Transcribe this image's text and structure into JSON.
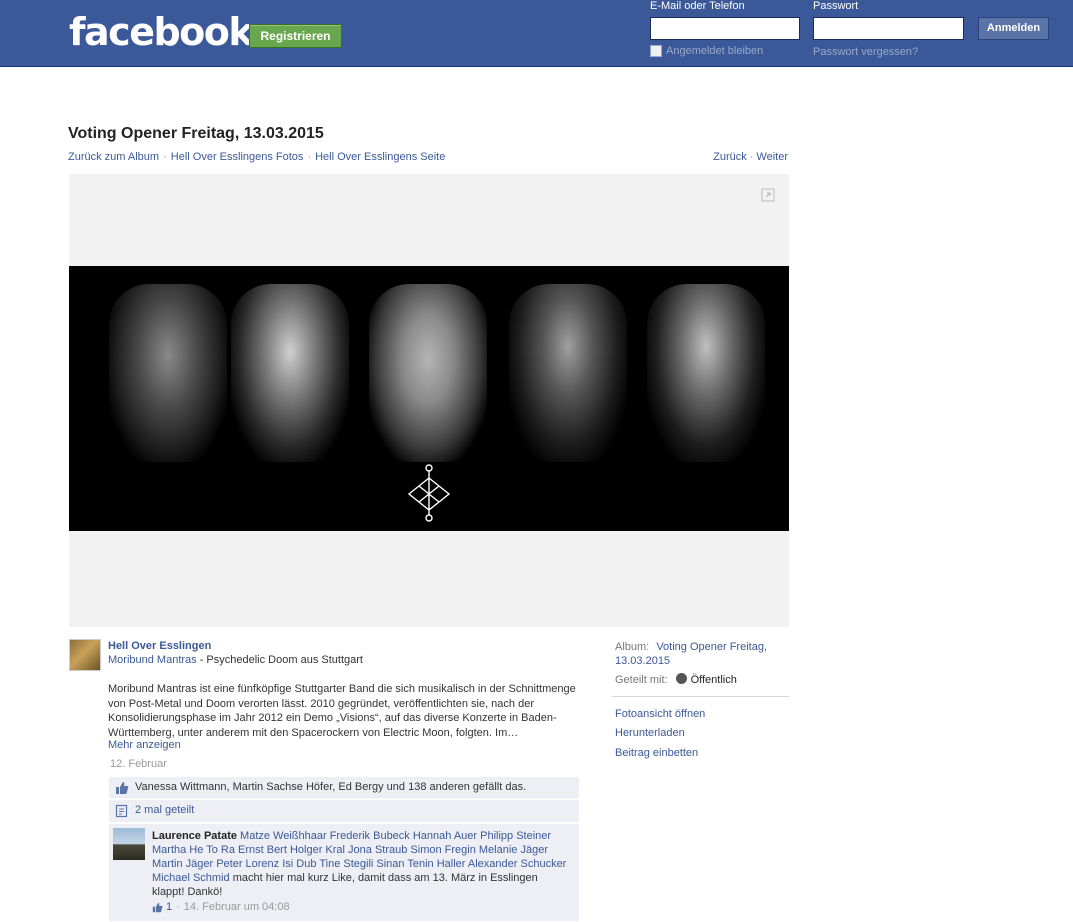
{
  "header": {
    "logo": "facebook",
    "register_label": "Registrieren",
    "email_label": "E-Mail oder Telefon",
    "password_label": "Passwort",
    "keep_logged_in": "Angemeldet bleiben",
    "forgot_password": "Passwort vergessen?",
    "login_label": "Anmelden"
  },
  "photo_page": {
    "title": "Voting Opener Freitag, 13.03.2015",
    "breadcrumbs": [
      "Zurück zum Album",
      "Hell Over Esslingens Fotos",
      "Hell Over Esslingens Seite"
    ],
    "nav": [
      "Zurück",
      "Weiter"
    ]
  },
  "post": {
    "author": "Hell Over Esslingen",
    "band_link": "Moribund Mantras",
    "band_tagline": " - Psychedelic Doom aus Stuttgart",
    "body": "Moribund Mantras ist eine fünfköpfige Stuttgarter Band die sich musikalisch in der Schnittmenge von Post-Metal und Doom verorten lässt. 2010 gegründet, veröffentlichten sie, nach der Konsolidierungsphase im Jahr 2012 ein Demo „Visions“, auf das diverse Konzerte in Baden-Württemberg, unter anderem mit den Spacerockern von Electric Moon, folgten. Im…",
    "more": "Mehr anzeigen",
    "date": "12. Februar",
    "likes": "Vanessa Wittmann, Martin Sachse Höfer, Ed Bergy und 138 anderen gefällt das.",
    "shares": "2 mal geteilt"
  },
  "comment": {
    "author": "Laurence Patate",
    "tags": "Matze Weißhhaar Frederik Bubeck Hannah Auer Philipp Steiner Martha He To Ra Ernst Bert Holger Kral Jona Straub Simon Fregin Melanie Jäger Martin Jäger Peter Lorenz Isi Dub Tine Stegili Sinan Tenin Haller Alexander Schucker Michael Schmid",
    "text": " macht hier mal kurz Like, damit dass am 13. März in Esslingen klappt! Dankö!",
    "like_count": "1",
    "timestamp": "14. Februar um 04:08"
  },
  "sidebar": {
    "album_label": "Album:",
    "album_name": "Voting Opener Freitag, 13.03.2015",
    "shared_label": "Geteilt mit:",
    "shared_value": "Öffentlich",
    "actions": [
      "Fotoansicht öffnen",
      "Herunterladen",
      "Beitrag einbetten"
    ]
  },
  "colors": {
    "brand": "#3b5998",
    "register_green": "#69a74e",
    "ufi_bg": "#edeff4"
  }
}
